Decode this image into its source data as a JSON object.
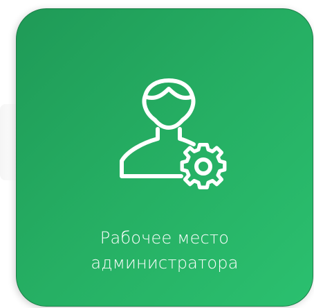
{
  "tile": {
    "label_line1": "Рабочее место",
    "label_line2": "администратора",
    "icon": "user-gear-icon"
  },
  "colors": {
    "tile_start": "#1f9a57",
    "tile_end": "#2bc06f",
    "foreground": "#ffffff"
  }
}
